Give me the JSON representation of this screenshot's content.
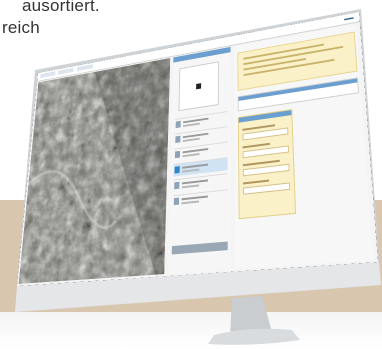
{
  "caption": {
    "line1": "ausortiert.",
    "line2": "reich"
  },
  "colors": {
    "background": "#ffffff",
    "band": "#d8c6ae",
    "monitor_frame": "#cfd3d6",
    "monitor_bezel": "#1a1a1a",
    "accent": "#6a9fd0",
    "info_panel": "#fbf1c9",
    "active_row": "#2f86c8"
  },
  "icons": [
    "monitor-stand-icon",
    "target-marker-icon"
  ]
}
